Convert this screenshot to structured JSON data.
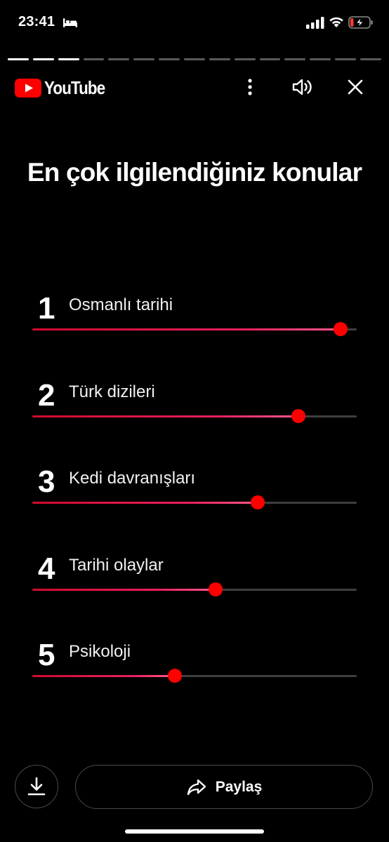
{
  "status_bar": {
    "time": "23:41",
    "icons": [
      "bed-icon",
      "signal-icon",
      "wifi-icon",
      "battery-charging-icon"
    ],
    "battery_color": "#ff3b30"
  },
  "story_progress": {
    "segments_total": 15,
    "segments_completed": 3
  },
  "header": {
    "logo_text": "YouTube",
    "brand_color": "#ff0000",
    "icons": [
      "more-vertical-icon",
      "volume-icon",
      "close-icon"
    ]
  },
  "page": {
    "title": "En çok ilgilendiğiniz konular"
  },
  "topics": [
    {
      "rank": "1",
      "label": "Osmanlı tarihi",
      "level": 0.95
    },
    {
      "rank": "2",
      "label": "Türk dizileri",
      "level": 0.82
    },
    {
      "rank": "3",
      "label": "Kedi davranışları",
      "level": 0.695
    },
    {
      "rank": "4",
      "label": "Tarihi olaylar",
      "level": 0.565
    },
    {
      "rank": "5",
      "label": "Psikoloji",
      "level": 0.44
    }
  ],
  "actions": {
    "share_label": "Paylaş",
    "icons": [
      "download-icon",
      "share-arrow-icon"
    ]
  },
  "colors": {
    "accent": "#ff0000",
    "track": "#3f3f3f",
    "background": "#000000"
  }
}
